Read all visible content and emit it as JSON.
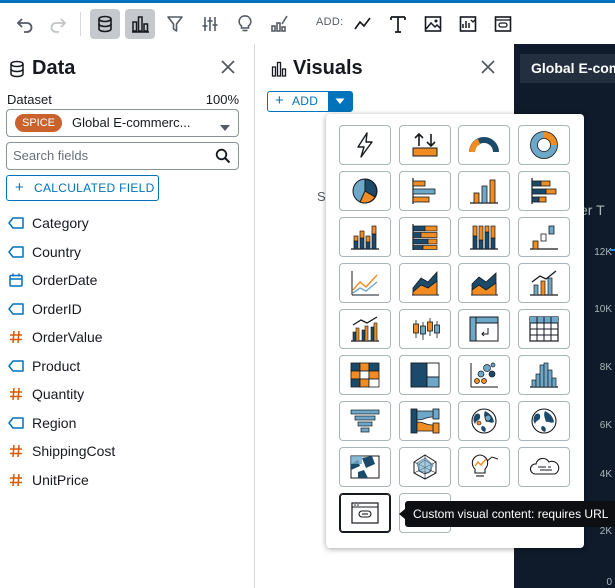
{
  "toolbar": {
    "add_label": "ADD:",
    "buttons": [
      "undo-icon",
      "redo-icon",
      "dataset-icon",
      "visuals-icon",
      "filter-icon",
      "controls-icon",
      "insights-icon",
      "themes-icon",
      "add-line-icon",
      "add-text-icon",
      "add-image-icon",
      "add-insight-icon",
      "add-custom-icon"
    ]
  },
  "data_panel": {
    "title": "Data",
    "dataset_label": "Dataset",
    "dataset_percent": "100%",
    "dataset_badge": "SPICE",
    "dataset_name": "Global E-commerc...",
    "search_placeholder": "Search fields",
    "calculated_field_label": "CALCULATED FIELD",
    "fields": [
      {
        "name": "Category",
        "type": "dimension"
      },
      {
        "name": "Country",
        "type": "dimension"
      },
      {
        "name": "OrderDate",
        "type": "date"
      },
      {
        "name": "OrderID",
        "type": "dimension"
      },
      {
        "name": "OrderValue",
        "type": "measure"
      },
      {
        "name": "Product",
        "type": "dimension"
      },
      {
        "name": "Quantity",
        "type": "measure"
      },
      {
        "name": "Region",
        "type": "dimension"
      },
      {
        "name": "ShippingCost",
        "type": "measure"
      },
      {
        "name": "UnitPrice",
        "type": "measure"
      }
    ]
  },
  "visuals_panel": {
    "title": "Visuals",
    "add_label": "ADD",
    "partial_text": "S"
  },
  "canvas": {
    "sheet_title": "Global E-com",
    "fragment_text": "er T",
    "y_ticks": [
      "12K",
      "10K",
      "8K",
      "6K",
      "4K",
      "2K",
      "0"
    ]
  },
  "visual_types": [
    "autograph-icon",
    "kpi-icon",
    "gauge-icon",
    "donut-chart-icon",
    "pie-chart-icon",
    "horizontal-bar-chart-icon",
    "vertical-bar-chart-icon",
    "horizontal-stacked-bar-icon",
    "vertical-stacked-bar-icon",
    "horizontal-100-stacked-bar-icon",
    "vertical-100-stacked-bar-icon",
    "waterfall-chart-icon",
    "line-chart-icon",
    "area-line-chart-icon",
    "stacked-area-chart-icon",
    "combo-bar-line-chart-icon",
    "clustered-combo-chart-icon",
    "box-plot-icon",
    "pivot-table-icon",
    "table-icon",
    "heat-map-icon",
    "tree-map-icon",
    "scatter-plot-icon",
    "histogram-icon",
    "funnel-chart-icon",
    "sankey-diagram-icon",
    "points-on-map-icon",
    "filled-map-icon",
    "filled-points-map-icon",
    "radar-chart-icon",
    "insight-icon",
    "word-cloud-icon",
    "custom-visual-content-icon",
    "embedded-code-icon"
  ],
  "tooltip_text": "Custom visual content: requires URL",
  "colors": {
    "accent": "#0073bb",
    "orange": "#f08c22",
    "navy": "#1b4a6b",
    "lightblue": "#6ea8c8",
    "spice": "#c9622c"
  }
}
